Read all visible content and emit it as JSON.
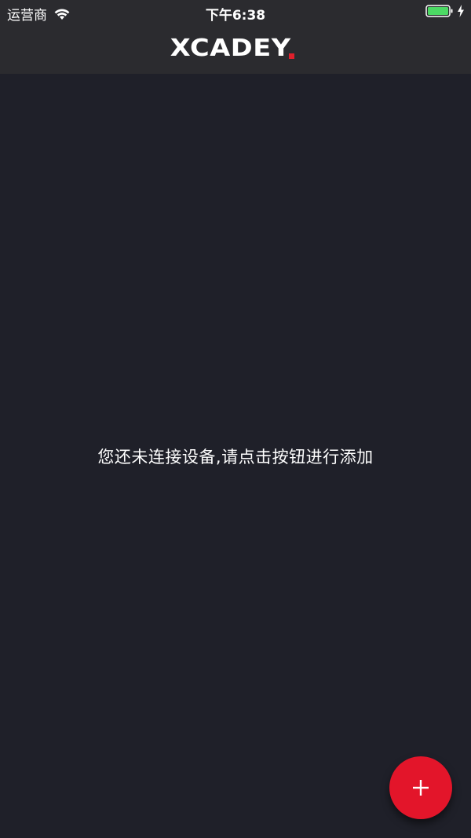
{
  "status_bar": {
    "carrier": "运营商",
    "time": "下午6:38",
    "icons": [
      "wifi-icon",
      "battery-icon",
      "charging-icon"
    ]
  },
  "nav": {
    "logo_text": "XCADEY",
    "logo_accent_color": "#e0202c"
  },
  "main": {
    "empty_message": "您还未连接设备,请点击按钮进行添加"
  },
  "fab": {
    "icon": "plus-icon",
    "color": "#e3152a"
  }
}
